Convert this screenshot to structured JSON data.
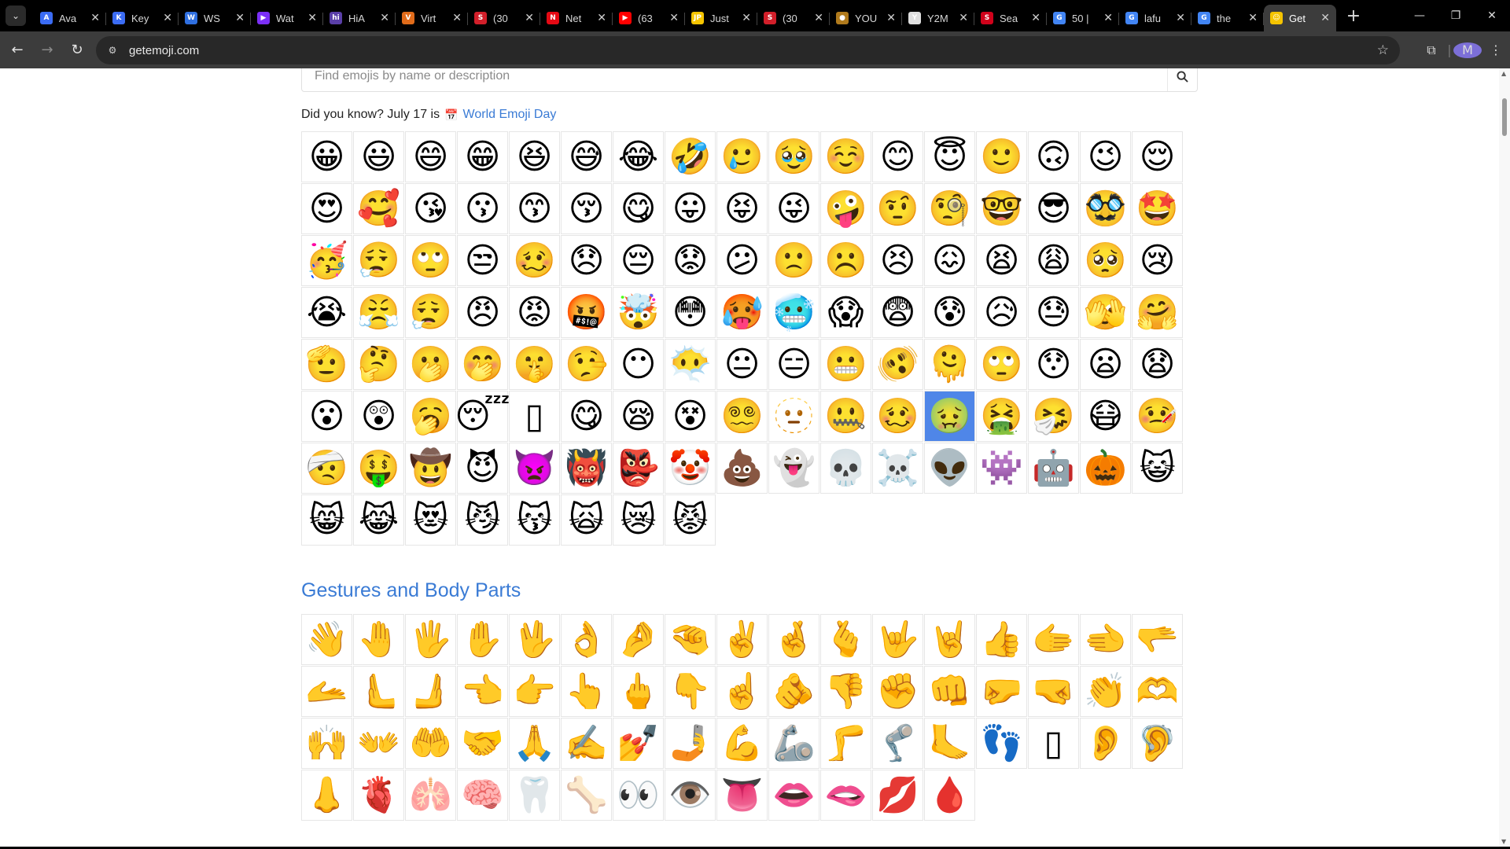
{
  "browser": {
    "tabs": [
      {
        "label": "Ava",
        "color": "#3b6cf4",
        "mark": "A"
      },
      {
        "label": "Key",
        "color": "#3b6cf4",
        "mark": "K"
      },
      {
        "label": "WS",
        "color": "#2f6fe0",
        "mark": "W"
      },
      {
        "label": "Wat",
        "color": "#7b2ff7",
        "mark": "▶"
      },
      {
        "label": "HiA",
        "color": "#5a3fa8",
        "mark": "hi"
      },
      {
        "label": "Virt",
        "color": "#e06b1a",
        "mark": "V"
      },
      {
        "label": "(30",
        "color": "#d21f2a",
        "mark": "S"
      },
      {
        "label": "Net",
        "color": "#e50914",
        "mark": "N"
      },
      {
        "label": "(63",
        "color": "#ff0000",
        "mark": "▶"
      },
      {
        "label": "Just",
        "color": "#f5c400",
        "mark": "JP"
      },
      {
        "label": "(30",
        "color": "#d21f2a",
        "mark": "S"
      },
      {
        "label": "YOU",
        "color": "#b07a1c",
        "mark": "●"
      },
      {
        "label": "Y2M",
        "color": "#e0e0e0",
        "mark": "Y"
      },
      {
        "label": "Sea",
        "color": "#d0021b",
        "mark": "S"
      },
      {
        "label": "50 |",
        "color": "#4285f4",
        "mark": "G"
      },
      {
        "label": "lafu",
        "color": "#4285f4",
        "mark": "G"
      },
      {
        "label": "the",
        "color": "#4285f4",
        "mark": "G"
      },
      {
        "label": "Get",
        "color": "#f5c400",
        "mark": "☺",
        "active": true
      }
    ],
    "url": "getemoji.com",
    "profile_initial": "M"
  },
  "page": {
    "search_placeholder": "Find emojis by name or description",
    "did_you_know_prefix": "Did you know? July 17 is",
    "did_you_know_link": "World Emoji Day",
    "section2_title": "Gestures and Body Parts"
  },
  "smileys": [
    "😀",
    "😃",
    "😄",
    "😁",
    "😆",
    "😅",
    "😂",
    "🤣",
    "🥲",
    "🥹",
    "☺️",
    "😊",
    "😇",
    "🙂",
    "🙃",
    "😉",
    "😌",
    "😍",
    "🥰",
    "😘",
    "😗",
    "😙",
    "😚",
    "😋",
    "😛",
    "😝",
    "😜",
    "🤪",
    "🤨",
    "🧐",
    "🤓",
    "😎",
    "🥸",
    "🤩",
    "🥳",
    "😮‍💨",
    "🙄",
    "😒",
    "🥴",
    "😞",
    "😔",
    "😟",
    "😕",
    "🙁",
    "☹️",
    "😣",
    "😖",
    "😫",
    "😩",
    "🥺",
    "😢",
    "😭",
    "😤",
    "😮‍💨",
    "😠",
    "😡",
    "🤬",
    "🤯",
    "😳",
    "🥵",
    "🥶",
    "😱",
    "😨",
    "😰",
    "😥",
    "😓",
    "🫣",
    "🤗",
    "🫡",
    "🤔",
    "🫢",
    "🤭",
    "🤫",
    "🤥",
    "😶",
    "😶‍🌫️",
    "😐",
    "😑",
    "😬",
    "🫨",
    "🫠",
    "🙄",
    "😯",
    "😦",
    "😧",
    "😮",
    "😲",
    "🥱",
    "😴",
    "▯",
    "😋",
    "😪",
    "😵",
    "😵‍💫",
    "🫥",
    "🤐",
    "🥴",
    "🤢",
    "🤮",
    "🤧",
    "😷",
    "🤒",
    "🤕",
    "🤑",
    "🤠",
    "😈",
    "👿",
    "👹",
    "👺",
    "🤡",
    "💩",
    "👻",
    "💀",
    "☠️",
    "👽",
    "👾",
    "🤖",
    "🎃",
    "😺",
    "😸",
    "😹",
    "😻",
    "😼",
    "😽",
    "🙀",
    "😿",
    "😾"
  ],
  "smileys_selected_index": 97,
  "gestures": [
    "👋",
    "🤚",
    "🖐️",
    "✋",
    "🖖",
    "👌",
    "🤌",
    "🤏",
    "✌️",
    "🤞",
    "🫰",
    "🤟",
    "🤘",
    "👍",
    "🫱",
    "🫲",
    "🫳",
    "🫴",
    "🫷",
    "🫸",
    "👈",
    "👉",
    "👆",
    "🖕",
    "👇",
    "☝️",
    "🫵",
    "👎",
    "✊",
    "👊",
    "🤛",
    "🤜",
    "👏",
    "🫶",
    "🙌",
    "👐",
    "🤲",
    "🤝",
    "🙏",
    "✍️",
    "💅",
    "🤳",
    "💪",
    "🦾",
    "🦵",
    "🦿",
    "🦶",
    "👣",
    "▯",
    "👂",
    "🦻",
    "👃",
    "🫀",
    "🫁",
    "🧠",
    "🦷",
    "🦴",
    "👀",
    "👁️",
    "👅",
    "👄",
    "🫦",
    "💋",
    "🩸"
  ]
}
